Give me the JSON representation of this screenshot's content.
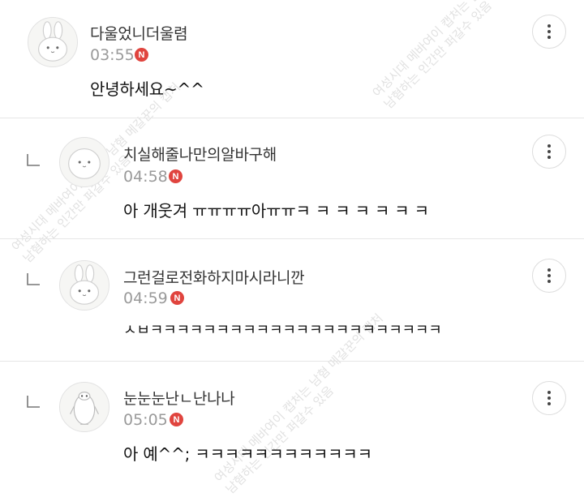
{
  "comments": [
    {
      "author": "다울었니더울렴",
      "time": "03:55",
      "badge": "N",
      "text": "안녕하세요~^^",
      "avatar_icon": "rabbit-icon"
    },
    {
      "author": "치실해줄나만의알바구해",
      "time": "04:58",
      "badge": "N",
      "text": "아 개웃겨 ㅠㅠㅠㅠ아ㅠㅠㅋ ㅋ ㅋ ㅋ ㅋ ㅋ ㅋ",
      "avatar_icon": "round-face-icon",
      "reply_icon": "reply-arrow-icon"
    },
    {
      "author": "그런걸로전화하지마시라니깐",
      "time": "04:59",
      "badge": "N",
      "text": "ㅅㅂㅋㅋㅋㅋㅋㅋㅋㅋㅋㅋㅋㅋㅋㅋㅋㅋㅋㅋㅋㅋㅋㅋ",
      "avatar_icon": "rabbit-icon",
      "reply_icon": "reply-arrow-icon"
    },
    {
      "author": "눈눈눈난ㄴ난나나",
      "time": "05:05",
      "badge": "N",
      "text": "아 예^^; ㅋㅋㅋㅋㅋㅋㅋㅋㅋㅋㅋㅋ",
      "avatar_icon": "penguin-icon",
      "reply_icon": "reply-arrow-icon"
    }
  ],
  "more_menu_icon": "more-vertical-icon",
  "watermark": {
    "line1": "여성시대 메바여이 캡처는 남혐 메갈꾼의 캡처",
    "line2": "남혐하는 인간만 퍼갈수 있음"
  },
  "colors": {
    "badge": "#e0443e",
    "time": "#9a9a9a",
    "divider": "#e6e6e6"
  }
}
